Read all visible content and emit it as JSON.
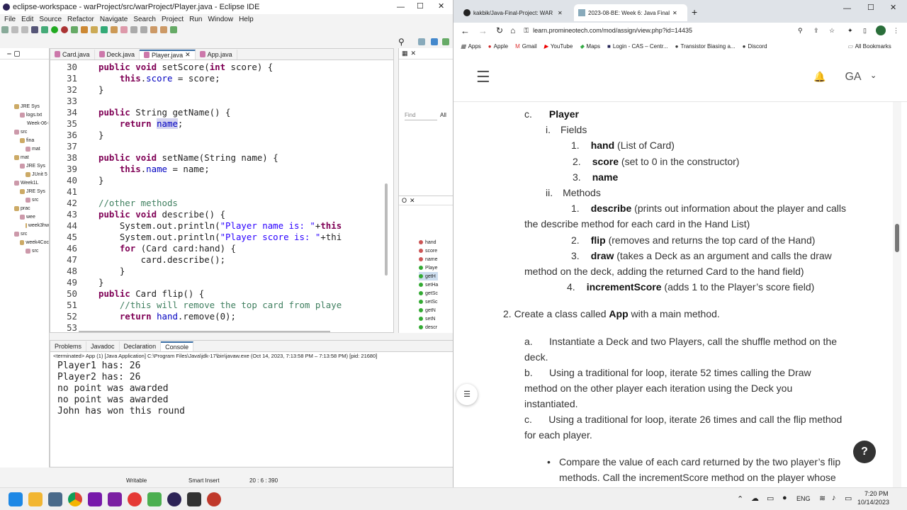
{
  "eclipse": {
    "title": "eclipse-workspace - warProject/src/warProject/Player.java - Eclipse IDE",
    "menu": [
      "File",
      "Edit",
      "Source",
      "Refactor",
      "Navigate",
      "Search",
      "Project",
      "Run",
      "Window",
      "Help"
    ],
    "editor_tabs": [
      "Card.java",
      "Deck.java",
      "Player.java",
      "App.java"
    ],
    "code_lines": [
      {
        "n": "30",
        "t": "    public void setScore(int score) {"
      },
      {
        "n": "31",
        "t": "        this.score = score;"
      },
      {
        "n": "32",
        "t": "    }"
      },
      {
        "n": "33",
        "t": ""
      },
      {
        "n": "34",
        "t": "    public String getName() {"
      },
      {
        "n": "35",
        "t": "        return name;"
      },
      {
        "n": "36",
        "t": "    }"
      },
      {
        "n": "37",
        "t": ""
      },
      {
        "n": "38",
        "t": "    public void setName(String name) {"
      },
      {
        "n": "39",
        "t": "        this.name = name;"
      },
      {
        "n": "40",
        "t": "    }"
      },
      {
        "n": "41",
        "t": ""
      },
      {
        "n": "42",
        "t": "    //other methods"
      },
      {
        "n": "43",
        "t": "    public void describe() {"
      },
      {
        "n": "44",
        "t": "        System.out.println(\"Player name is: \"+this"
      },
      {
        "n": "45",
        "t": "        System.out.println(\"Player score is: \"+thi"
      },
      {
        "n": "46",
        "t": "        for (Card card:hand) {"
      },
      {
        "n": "47",
        "t": "            card.describe();"
      },
      {
        "n": "48",
        "t": "        }"
      },
      {
        "n": "49",
        "t": "    }"
      },
      {
        "n": "50",
        "t": "    public Card flip() {"
      },
      {
        "n": "51",
        "t": "        //this will remove the top card from playe"
      },
      {
        "n": "52",
        "t": "        return hand.remove(0);"
      },
      {
        "n": "53",
        "t": ""
      }
    ],
    "package_items": [
      "JRE Sys",
      "logs.txt",
      "Week-06-I",
      "src",
      "fina",
      "mat",
      "mat",
      "JRE Sys",
      "JUnit 5",
      "Week1L",
      "JRE Sys",
      "src",
      "prac",
      "wee",
      "week3hw",
      "src",
      "week4Coc",
      "src"
    ],
    "find_placeholder": "Find",
    "find_all": "All",
    "outline_items": [
      "hand",
      "score",
      "name",
      "Playe",
      "getH",
      "setHa",
      "getSc",
      "setSc",
      "getN",
      "setN",
      "descr"
    ],
    "console_tabs": [
      "Problems",
      "Javadoc",
      "Declaration",
      "Console"
    ],
    "console_header": "<terminated> App (1) [Java Application] C:\\Program Files\\Java\\jdk-17\\bin\\javaw.exe  (Oct 14, 2023, 7:13:58 PM – 7:13:58 PM) [pid: 21680]",
    "console_lines": [
      "Player1 has: 26",
      "Player2 has: 26",
      "no point was awarded",
      "no point was awarded",
      "John has won this round"
    ],
    "status": {
      "writable": "Writable",
      "insert": "Smart Insert",
      "pos": "20 : 6 : 390"
    }
  },
  "browser": {
    "tabs": [
      {
        "label": "kakbik/Java-Final-Project: WAR"
      },
      {
        "label": "2023-08-BE: Week 6: Java Final"
      }
    ],
    "url": "learn.promineotech.com/mod/assign/view.php?id=14435",
    "bookmarks": [
      "Apps",
      "Apple",
      "Gmail",
      "YouTube",
      "Maps",
      "Login - CAS – Centr...",
      "Transistor Biasing a...",
      "Discord",
      "All Bookmarks"
    ],
    "avatar": "GA",
    "content": {
      "c_label": "c.",
      "c_title": "Player",
      "i_label": "i.",
      "i_text": "Fields",
      "f1n": "1.",
      "f1b": "hand",
      "f1t": " (List of Card)",
      "f2n": "2.",
      "f2b": "score",
      "f2t": " (set to 0 in the constructor)",
      "f3n": "3.",
      "f3b": "name",
      "ii_label": "ii.",
      "ii_text": "Methods",
      "m1n": "1.",
      "m1b": "describe",
      "m1t": " (prints out information about the player and calls",
      "m1c": "the describe method for each card in the Hand List)",
      "m2n": "2.",
      "m2b": "flip",
      "m2t": " (removes and returns the top card of the Hand)",
      "m3n": "3.",
      "m3b": "draw",
      "m3t": " (takes a Deck as an argument and calls the draw",
      "m3c": "method on the deck, adding the returned Card to the hand field)",
      "m4n": "4.",
      "m4b": "incrementScore",
      "m4t": " (adds 1 to the Player’s score field)",
      "s2a": "2. Create a class called ",
      "s2b": "App",
      "s2c": " with a main method.",
      "a1": "a.      Instantiate a Deck and two Players, call the shuffle method on the",
      "a2": "deck.",
      "b1": "b.      Using a traditional for loop, iterate 52 times calling the Draw",
      "b2": "method on the other player each iteration using the Deck you",
      "b3": "instantiated.",
      "c1": "c.      Using a traditional for loop, iterate 26 times and call the flip method",
      "c2": "for each player.",
      "d1": "Compare the value of each card returned by the two player’s flip",
      "d2": "methods. Call the incrementScore method on the player whose",
      "help": "?"
    }
  },
  "taskbar": {
    "lang": "ENG",
    "time": "7:20 PM",
    "date": "10/14/2023"
  }
}
